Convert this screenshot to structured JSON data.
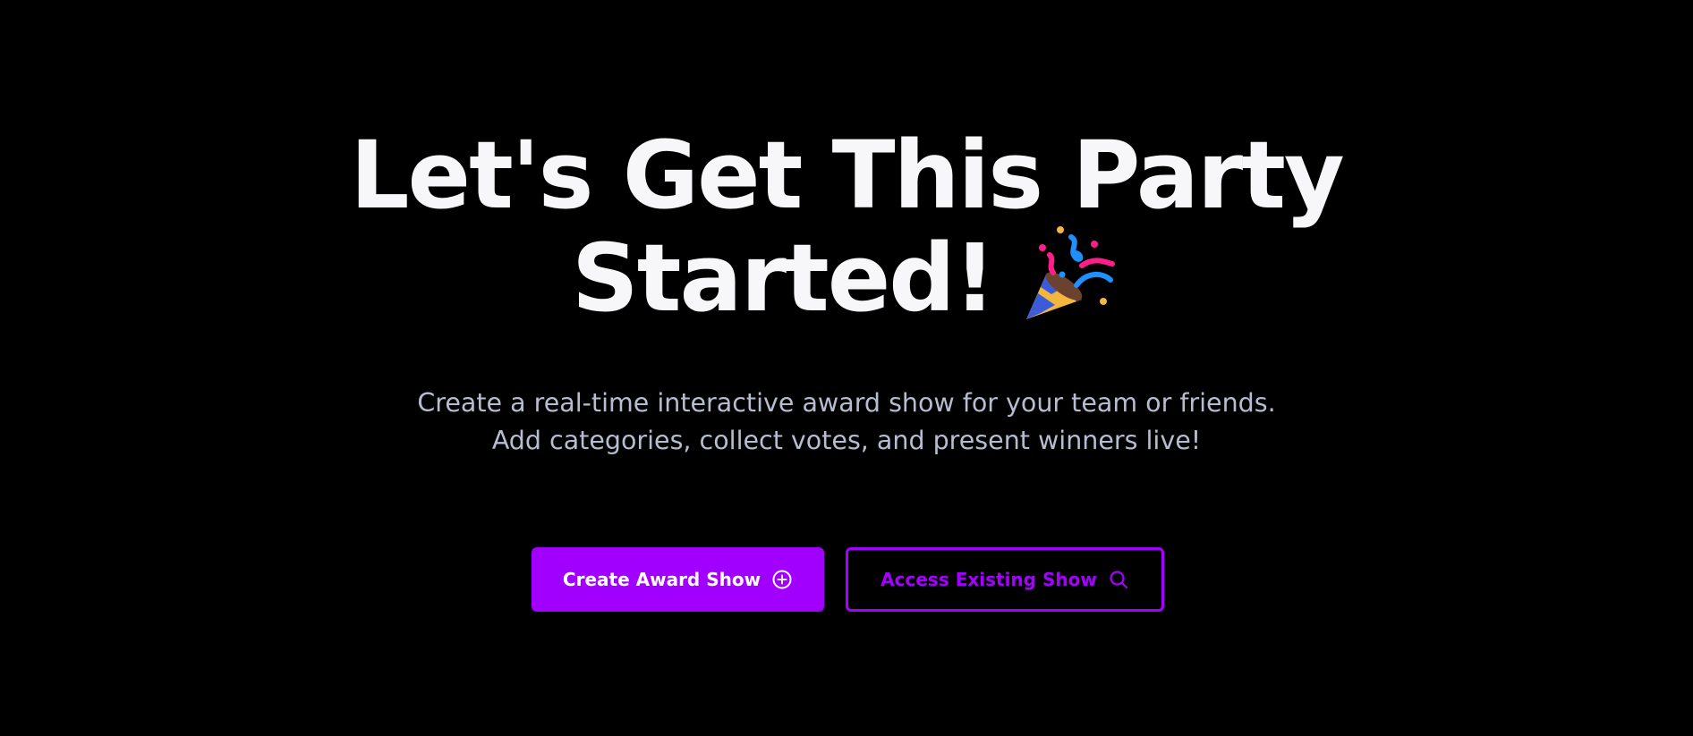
{
  "hero": {
    "headline_line1": "Let's Get This Party",
    "headline_line2": "Started!",
    "headline_emoji": "party-popper-icon",
    "subtitle": "Create a real-time interactive award show for your team or friends. Add categories, collect votes, and present winners live!"
  },
  "actions": {
    "create": {
      "label": "Create Award Show",
      "icon": "plus-circle-icon"
    },
    "access": {
      "label": "Access Existing Show",
      "icon": "search-icon"
    }
  },
  "colors": {
    "background": "#000000",
    "accent": "#a100ff",
    "headline": "#f7f7f9",
    "subtitle": "#b6bdd0"
  }
}
